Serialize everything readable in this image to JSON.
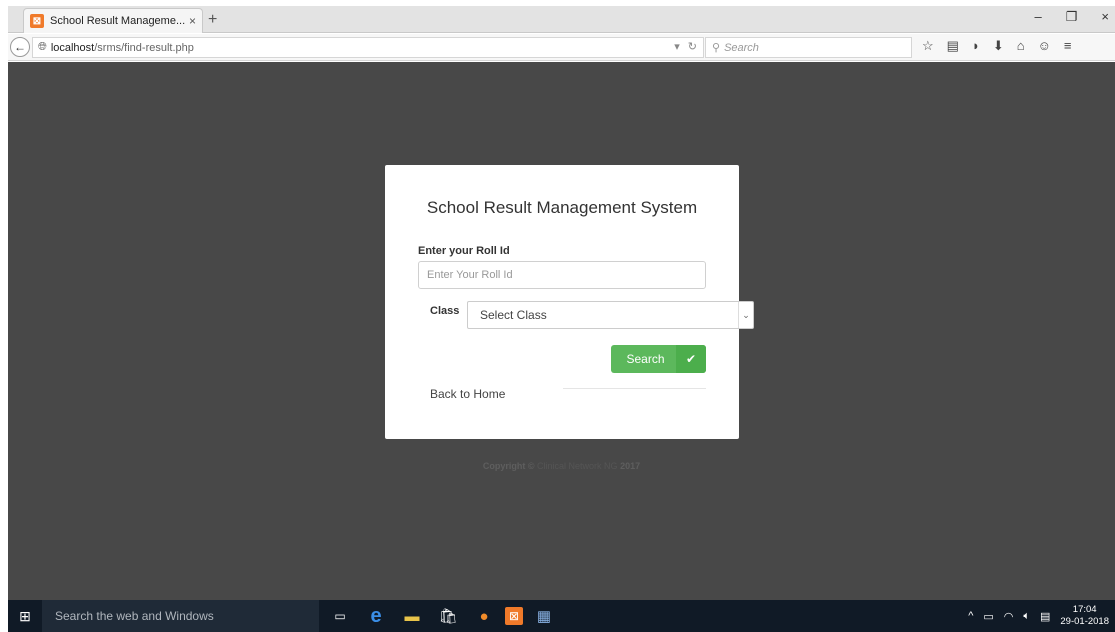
{
  "browser": {
    "tab_title": "School Result Manageme...",
    "tab_close": "×",
    "new_tab": "+",
    "url_host": "localhost",
    "url_path": "/srms/find-result.php",
    "search_placeholder": "Search",
    "window_controls": [
      "–",
      "❐",
      "×"
    ]
  },
  "page": {
    "title": "School Result Management System",
    "roll_label": "Enter your Roll Id",
    "roll_placeholder": "Enter Your Roll Id",
    "class_label": "Class",
    "class_select_value": "Select Class",
    "search_button": "Search",
    "back_home": "Back to Home",
    "copyright_prefix": "Copyright ©",
    "copyright_brand": "Clinical Network NG",
    "copyright_year": "2017"
  },
  "taskbar": {
    "search_text": "Search the web and Windows",
    "time": "17:04",
    "date": "29-01-2018"
  },
  "colors": {
    "page_background": "#484848",
    "button_green": "#5cb85c",
    "taskbar": "#101a26"
  }
}
